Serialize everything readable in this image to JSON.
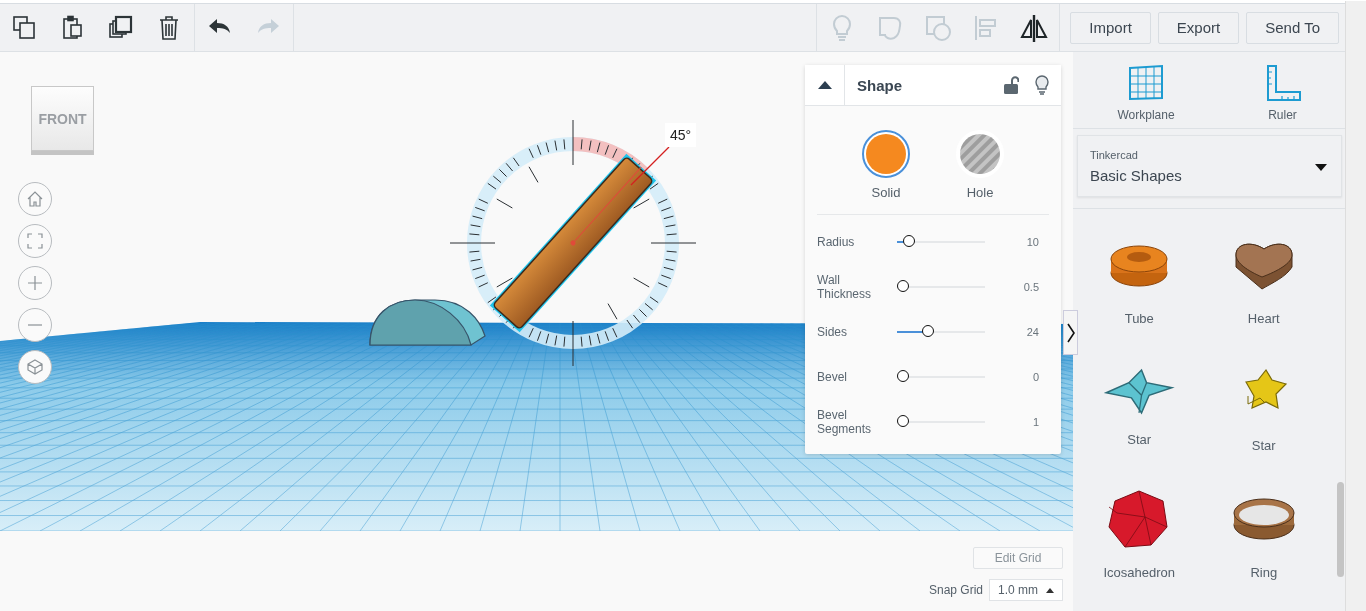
{
  "toolbar": {
    "edit_tools": [
      {
        "kind": "copy"
      },
      {
        "kind": "paste"
      },
      {
        "kind": "duplicate"
      },
      {
        "kind": "delete"
      }
    ],
    "history": [
      {
        "kind": "undo",
        "disabled": false
      },
      {
        "kind": "redo",
        "disabled": true
      }
    ],
    "view_tools": [
      {
        "kind": "lightbulb",
        "disabled": true
      },
      {
        "kind": "group",
        "disabled": true
      },
      {
        "kind": "hole-group",
        "disabled": true
      },
      {
        "kind": "align",
        "disabled": true
      },
      {
        "kind": "mirror",
        "disabled": false
      }
    ],
    "buttons": [
      "Import",
      "Export",
      "Send To"
    ]
  },
  "view_cube": {
    "label": "FRONT"
  },
  "nav_buttons": [
    {
      "kind": "home"
    },
    {
      "kind": "fit"
    },
    {
      "kind": "zoom-in"
    },
    {
      "kind": "zoom-out"
    },
    {
      "kind": "perspective"
    }
  ],
  "rotation": {
    "angle_label": "45°"
  },
  "inspector": {
    "title": "Shape",
    "locked": false,
    "fill_options": [
      {
        "label": "Solid",
        "kind": "solid",
        "selected": true
      },
      {
        "label": "Hole",
        "kind": "hole",
        "selected": false
      }
    ],
    "params": [
      {
        "name": "Radius",
        "value": "10",
        "level": 0.08
      },
      {
        "name": "Wall Thickness",
        "value": "0.5",
        "level": 0
      },
      {
        "name": "Sides",
        "value": "24",
        "level": 0.33
      },
      {
        "name": "Bevel",
        "value": "0",
        "level": 0
      },
      {
        "name": "Bevel Segments",
        "value": "1",
        "level": 0
      }
    ]
  },
  "grid_controls": {
    "edit_button": "Edit Grid",
    "snap_label": "Snap Grid",
    "snap_value": "1.0 mm"
  },
  "side_panel": {
    "tools": [
      {
        "label": "Workplane",
        "kind": "workplane"
      },
      {
        "label": "Ruler",
        "kind": "ruler"
      }
    ],
    "library": {
      "source": "Tinkercad",
      "name": "Basic Shapes"
    },
    "shapes": [
      {
        "label": "Tube",
        "kind": "tube"
      },
      {
        "label": "Heart",
        "kind": "heart"
      },
      {
        "label": "Star",
        "kind": "spikystar"
      },
      {
        "label": "Star",
        "kind": "star"
      },
      {
        "label": "Icosahedron",
        "kind": "icosahedron"
      },
      {
        "label": "Ring",
        "kind": "ring"
      }
    ]
  }
}
